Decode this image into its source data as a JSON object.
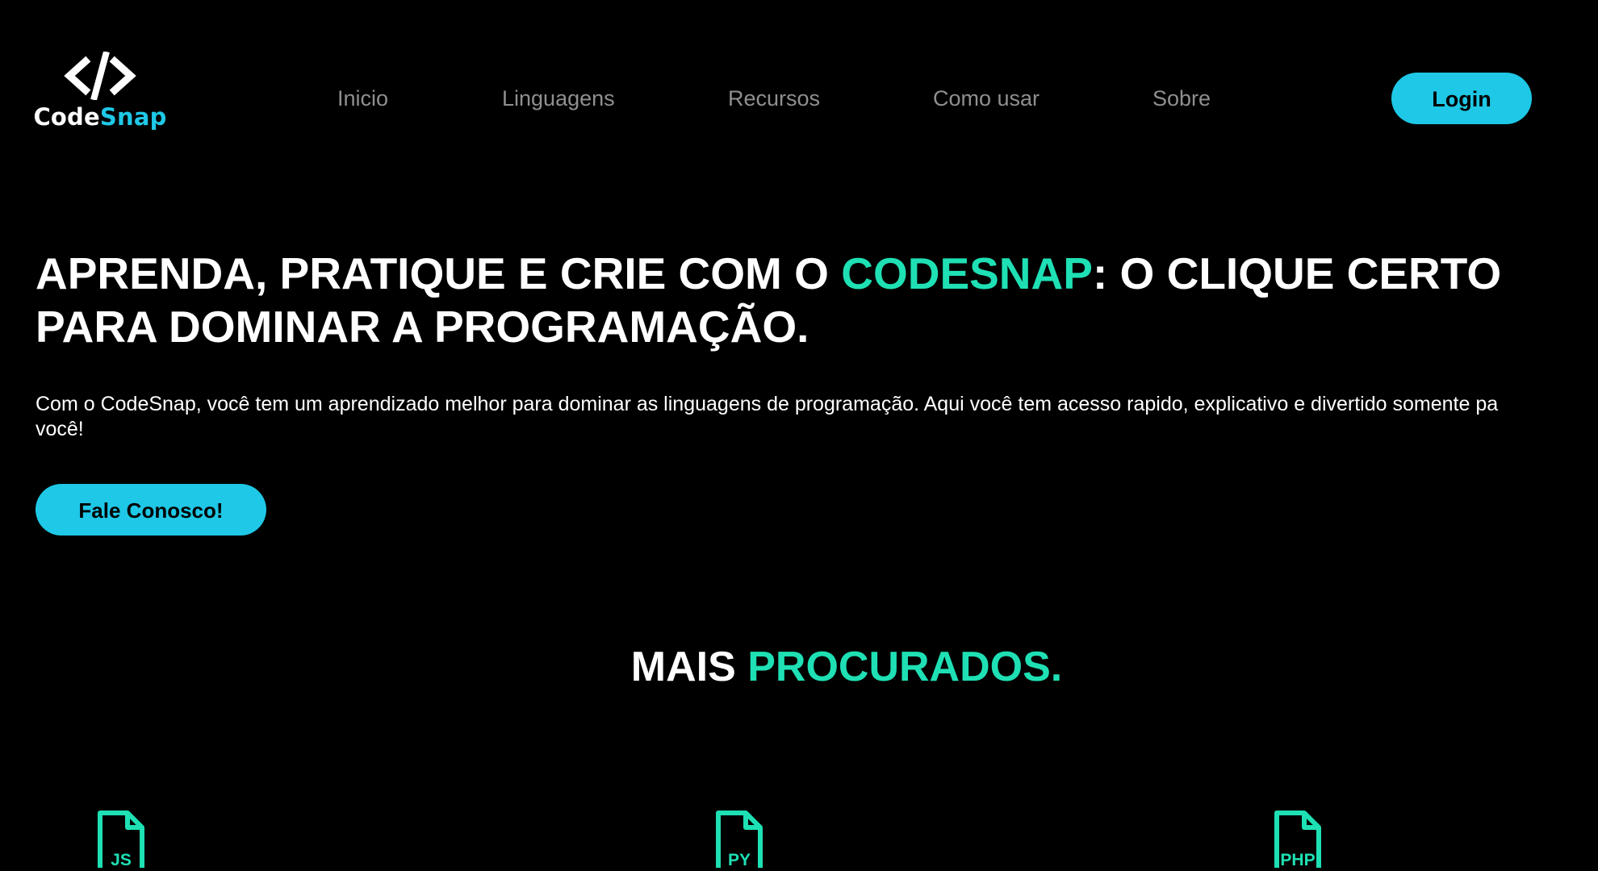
{
  "logo": {
    "symbol": "</>",
    "word_a": "Code",
    "word_b": "Snap"
  },
  "nav": {
    "items": [
      {
        "label": "Inicio"
      },
      {
        "label": "Linguagens"
      },
      {
        "label": "Recursos"
      },
      {
        "label": "Como usar"
      },
      {
        "label": "Sobre"
      }
    ]
  },
  "header": {
    "login_label": "Login"
  },
  "hero": {
    "title_part1": "APRENDA, PRATIQUE E CRIE COM O ",
    "title_accent": "CODESNAP",
    "title_part2": ": O CLIQUE CERTO",
    "title_line2": "PARA DOMINAR A PROGRAMAÇÃO.",
    "description_line1": "Com o CodeSnap, você tem um aprendizado melhor para dominar as linguagens de programação. Aqui você tem acesso rapido, explicativo e divertido somente pa",
    "description_line2": "você!",
    "cta_label": "Fale Conosco!"
  },
  "section": {
    "title_part1": "MAIS ",
    "title_accent": "PROCURADOS."
  },
  "languages": [
    {
      "label": "JS",
      "icon": "js-file-icon"
    },
    {
      "label": "PY",
      "icon": "py-file-icon"
    },
    {
      "label": "PHP",
      "icon": "php-file-icon"
    }
  ],
  "colors": {
    "background": "#000000",
    "primary_button": "#1ec8e6",
    "accent_text": "#1ee0b4",
    "nav_text": "#8f8f8f",
    "text": "#ffffff"
  }
}
